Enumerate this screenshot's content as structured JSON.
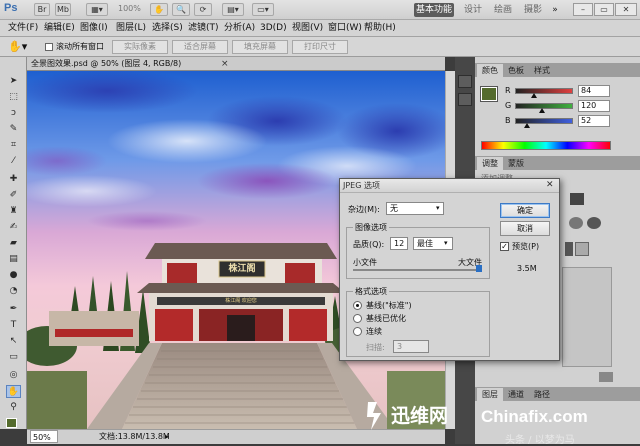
{
  "app": {
    "logo": "Ps",
    "workspace_buttons": [
      "基本功能",
      "设计",
      "绘画",
      "摄影"
    ],
    "more": "»",
    "zoom": "100%"
  },
  "window_controls": [
    "–",
    "▭",
    "✕"
  ],
  "menu": [
    "文件(F)",
    "编辑(E)",
    "图像(I)",
    "图层(L)",
    "选择(S)",
    "滤镜(T)",
    "分析(A)",
    "3D(D)",
    "视图(V)",
    "窗口(W)",
    "帮助(H)"
  ],
  "options": {
    "scroll_all_label": "滚动所有窗口",
    "buttons": [
      "实际像素",
      "适合屏幕",
      "填充屏幕",
      "打印尺寸"
    ]
  },
  "document": {
    "tab_title": "全景图效果.psd @ 50% (图层 4, RGB/8)",
    "close": "×",
    "zoom": "50%",
    "doc_info": "文档:13.8M/13.8M"
  },
  "panels": {
    "color_tabs": [
      "颜色",
      "色板",
      "样式"
    ],
    "rgb": [
      {
        "name": "R",
        "value": "84",
        "fill": 0.33,
        "color": "#e04040"
      },
      {
        "name": "G",
        "value": "120",
        "fill": 0.47,
        "color": "#40b040"
      },
      {
        "name": "B",
        "value": "52",
        "fill": 0.2,
        "color": "#4060e0"
      }
    ],
    "adjust_tabs": [
      "调整",
      "蒙版"
    ],
    "adjust_heading": "添加调整",
    "layer_tabs": [
      "图层",
      "通道",
      "路径"
    ]
  },
  "dialog": {
    "title": "JPEG 选项",
    "matte_label": "杂边(M):",
    "matte_value": "无",
    "image_options_label": "图像选项",
    "quality_label": "品质(Q):",
    "quality_value": "12",
    "quality_level": "最佳",
    "small_file": "小文件",
    "large_file": "大文件",
    "format_options_label": "格式选项",
    "formats": [
      "基线(\"标准\")",
      "基线已优化",
      "连续"
    ],
    "selected_format": 0,
    "scans_label": "扫描:",
    "scans_value": "3",
    "ok": "确定",
    "cancel": "取消",
    "preview_label": "预览(P)",
    "preview_checked": true,
    "file_size": "3.5M"
  },
  "photo": {
    "sign_text": "株江阁",
    "banner_text": "株江阁 欢迎您"
  },
  "watermark": {
    "site": "迅维网",
    "domain": "Chinafix.com",
    "faint_text": "头条 / 以梦为马"
  }
}
